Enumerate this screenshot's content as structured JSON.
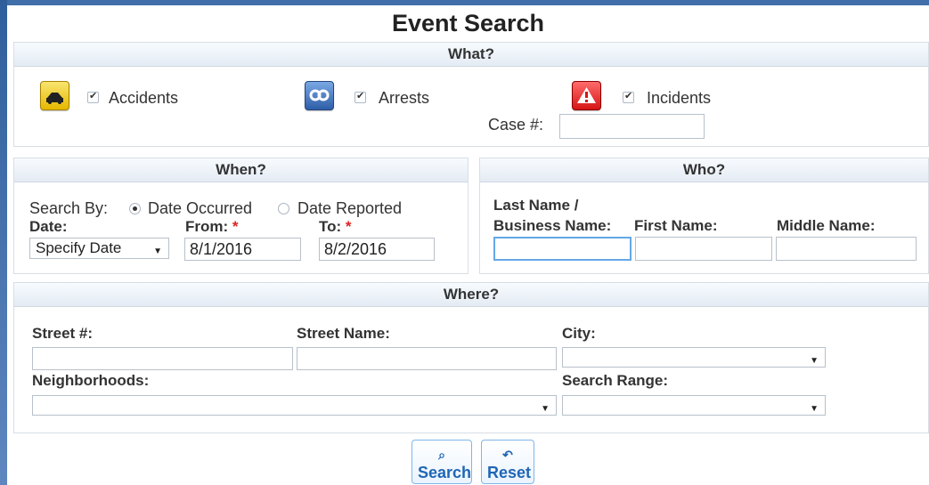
{
  "page": {
    "title": "Event Search"
  },
  "what": {
    "header": "What?",
    "options": [
      {
        "label": "Accidents",
        "checked": true,
        "icon": "car-crash-icon",
        "icon_color": "#f0c419"
      },
      {
        "label": "Arrests",
        "checked": true,
        "icon": "handcuffs-icon",
        "icon_color": "#2f6db8"
      },
      {
        "label": "Incidents",
        "checked": true,
        "icon": "warning-icon",
        "icon_color": "#e02020"
      }
    ],
    "case_label": "Case #:",
    "case_value": ""
  },
  "when": {
    "header": "When?",
    "search_by_label": "Search By:",
    "search_by_options": [
      {
        "label": "Date Occurred",
        "selected": true
      },
      {
        "label": "Date Reported",
        "selected": false
      }
    ],
    "date_label": "Date:",
    "date_mode": "Specify Date",
    "from_label": "From:",
    "from_value": "8/1/2016",
    "to_label": "To:",
    "to_value": "8/2/2016",
    "required_mark": "*"
  },
  "who": {
    "header": "Who?",
    "last_name_label_1": "Last Name /",
    "last_name_label_2": "Business Name:",
    "first_name_label": "First Name:",
    "middle_name_label": "Middle Name:",
    "last_name_value": "",
    "first_name_value": "",
    "middle_name_value": ""
  },
  "where": {
    "header": "Where?",
    "street_number_label": "Street #:",
    "street_name_label": "Street Name:",
    "city_label": "City:",
    "neighborhoods_label": "Neighborhoods:",
    "search_range_label": "Search Range:",
    "street_number_value": "",
    "street_name_value": "",
    "city_value": "",
    "neighborhood_value": "",
    "search_range_value": ""
  },
  "actions": {
    "search_label": "Search",
    "reset_label": "Reset"
  },
  "colors": {
    "accent": "#1f66b5",
    "focus_border": "#64a8e8",
    "required": "#d22222"
  }
}
